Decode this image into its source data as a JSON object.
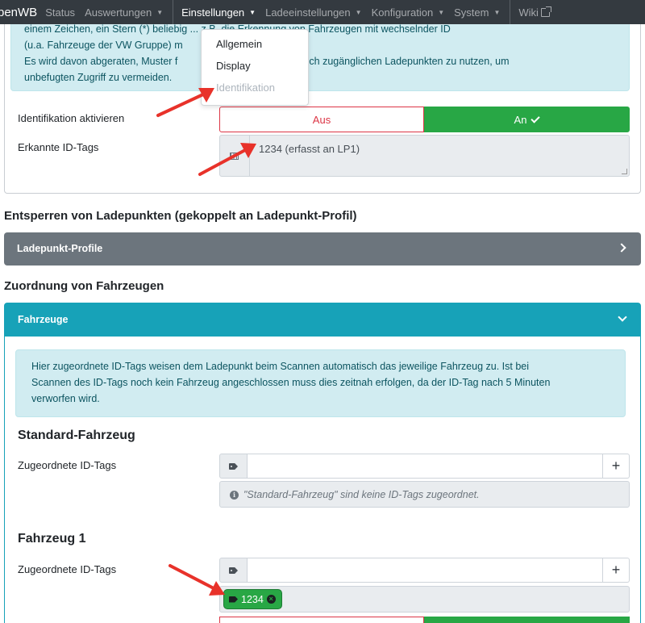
{
  "navbar": {
    "brand": "penWB",
    "items": [
      {
        "label": "Status",
        "caret": false
      },
      {
        "label": "Auswertungen",
        "caret": true
      },
      {
        "label": "Einstellungen",
        "caret": true,
        "active": true
      },
      {
        "label": "Ladeeinstellungen",
        "caret": true
      },
      {
        "label": "Konfiguration",
        "caret": true
      },
      {
        "label": "System",
        "caret": true
      },
      {
        "label": "Wiki",
        "external": true
      }
    ]
  },
  "dropdown": {
    "items": [
      "Allgemein",
      "Display",
      "Identifikation"
    ]
  },
  "top_card": {
    "alert_lines": [
      "einem Zeichen, ein Stern (*) beliebig ... z.B. die Erkennung von Fahrzeugen mit wechselnder ID",
      "(u.a. Fahrzeuge der VW Gruppe) m",
      "Es wird davon abgeraten, Muster f",
      "unbefugten Zugriff zu vermeiden."
    ],
    "alert_line2_tail": "n öffentlich zugänglichen Ladepunkten zu nutzen, um",
    "identification_label": "Identifikation aktivieren",
    "toggle_off": "Aus",
    "toggle_on": "An",
    "detected_label": "Erkannte ID-Tags",
    "detected_value": "1234 (erfasst an LP1)"
  },
  "section_unlock": {
    "title": "Entsperren von Ladepunkten (gekoppelt an Ladepunkt-Profil)",
    "collapse_label": "Ladepunkt-Profile"
  },
  "section_vehicles": {
    "title": "Zuordnung von Fahrzeugen",
    "card_header": "Fahrzeuge",
    "alert_lines": [
      "Hier zugeordnete ID-Tags weisen dem Ladepunkt beim Scannen automatisch das jeweilige Fahrzeug zu. Ist bei",
      "Scannen des ID-Tags noch kein Fahrzeug angeschlossen muss dies zeitnah erfolgen, da der ID-Tag nach 5 Minuten",
      "verworfen wird."
    ],
    "standard": {
      "title": "Standard-Fahrzeug",
      "label": "Zugeordnete ID-Tags",
      "add": "+",
      "info": "\"Standard-Fahrzeug\" sind keine ID-Tags zugeordnet."
    },
    "vehicle1": {
      "title": "Fahrzeug 1",
      "label": "Zugeordnete ID-Tags",
      "add": "+",
      "tag": "1234"
    }
  },
  "colors": {
    "navbar": "#343a40",
    "success": "#28a745",
    "danger": "#dc3545",
    "info": "#17a2b8",
    "secondary": "#6c757d",
    "arrow": "#e8322a"
  }
}
